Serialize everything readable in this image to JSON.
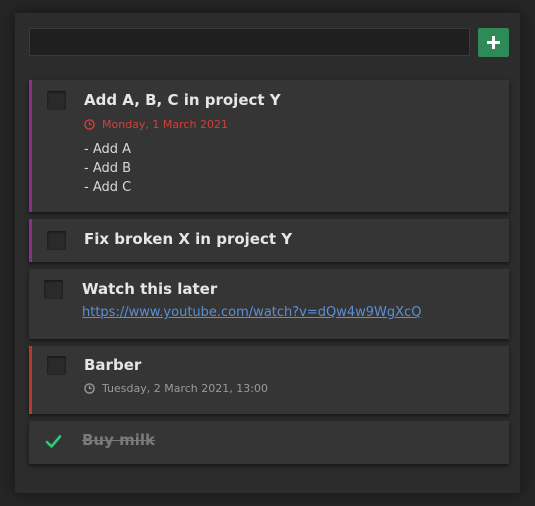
{
  "new_task": {
    "value": "",
    "placeholder": ""
  },
  "tasks": [
    {
      "title": "Add A, B, C in project Y",
      "due": "Monday, 1 March 2021",
      "notes": [
        "- Add A",
        "- Add B",
        "- Add C"
      ],
      "completed": false
    },
    {
      "title": "Fix broken X in project Y",
      "completed": false
    },
    {
      "title": "Watch this later",
      "link": "https://www.youtube.com/watch?v=dQw4w9WgXcQ",
      "completed": false
    },
    {
      "title": "Barber",
      "due": "Tuesday, 2 March 2021, 13:00",
      "completed": false
    },
    {
      "title": "Buy milk",
      "completed": true
    }
  ],
  "colors": {
    "background": "#262626",
    "card": "#353535",
    "accent_purple": "#8b2f8f",
    "accent_red": "#b33a2e",
    "overdue_text": "#d0403a",
    "add_button": "#2e8b57",
    "link": "#5b8fd6",
    "check": "#2ecc71"
  },
  "icons": {
    "add": "plus-icon",
    "due": "clock-icon",
    "done": "checkmark-icon"
  }
}
